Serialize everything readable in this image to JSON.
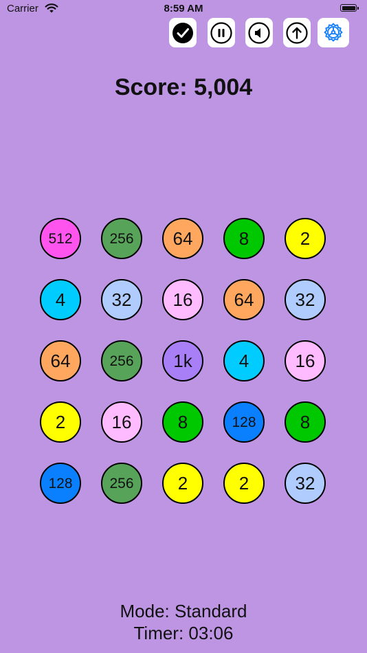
{
  "status_bar": {
    "carrier": "Carrier",
    "time": "8:59 AM"
  },
  "toolbar": {
    "buttons": [
      {
        "name": "confirm",
        "icon": "checkmark-circle-icon"
      },
      {
        "name": "pause",
        "icon": "pause-circle-icon"
      },
      {
        "name": "sound",
        "icon": "speaker-icon"
      },
      {
        "name": "share",
        "icon": "arrow-up-circle-icon"
      },
      {
        "name": "settings",
        "icon": "gear-icon",
        "color": "#1a82f7"
      }
    ]
  },
  "score": {
    "text": "Score: 5,004"
  },
  "board": {
    "rows": [
      [
        {
          "label": "512",
          "color": "#ff55ee"
        },
        {
          "label": "256",
          "color": "#57a35a"
        },
        {
          "label": "64",
          "color": "#ffa75e"
        },
        {
          "label": "8",
          "color": "#00c800"
        },
        {
          "label": "2",
          "color": "#ffff00"
        }
      ],
      [
        {
          "label": "4",
          "color": "#00ccff"
        },
        {
          "label": "32",
          "color": "#b0ccff"
        },
        {
          "label": "16",
          "color": "#ffbbff"
        },
        {
          "label": "64",
          "color": "#ffa75e"
        },
        {
          "label": "32",
          "color": "#b0ccff"
        }
      ],
      [
        {
          "label": "64",
          "color": "#ffa75e"
        },
        {
          "label": "256",
          "color": "#57a35a"
        },
        {
          "label": "1k",
          "color": "#a87ff7"
        },
        {
          "label": "4",
          "color": "#00ccff"
        },
        {
          "label": "16",
          "color": "#ffbbff"
        }
      ],
      [
        {
          "label": "2",
          "color": "#ffff00"
        },
        {
          "label": "16",
          "color": "#ffbbff"
        },
        {
          "label": "8",
          "color": "#00c800"
        },
        {
          "label": "128",
          "color": "#0a80ff"
        },
        {
          "label": "8",
          "color": "#00c800"
        }
      ],
      [
        {
          "label": "128",
          "color": "#0a80ff"
        },
        {
          "label": "256",
          "color": "#57a35a"
        },
        {
          "label": "2",
          "color": "#ffff00"
        },
        {
          "label": "2",
          "color": "#ffff00"
        },
        {
          "label": "32",
          "color": "#b0ccff"
        }
      ]
    ]
  },
  "footer": {
    "mode": "Mode: Standard",
    "timer": "Timer: 03:06"
  },
  "colors": {
    "background": "#bd95e3",
    "accent": "#1a82f7"
  }
}
